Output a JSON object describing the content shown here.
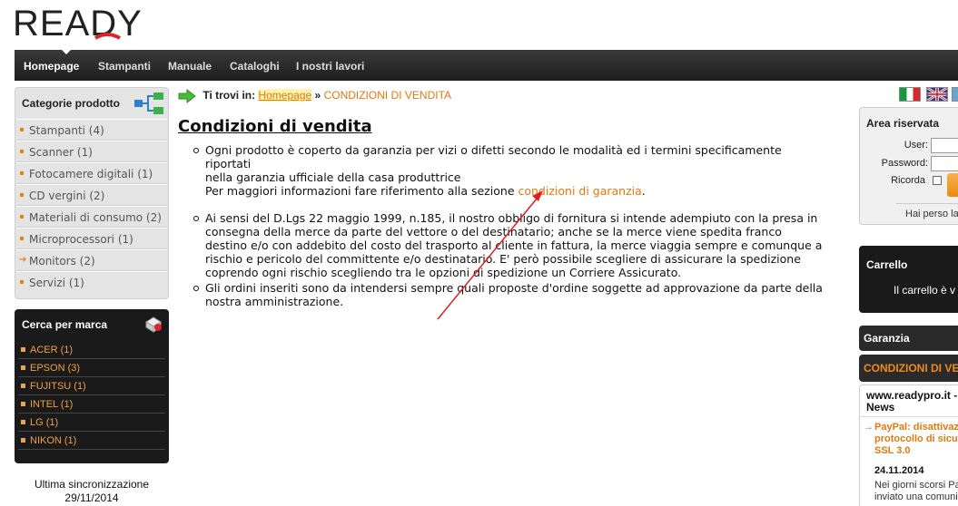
{
  "header": {
    "logo_text": "READY"
  },
  "nav": {
    "items": [
      {
        "label": "Homepage",
        "active": true
      },
      {
        "label": "Stampanti"
      },
      {
        "label": "Manuale"
      },
      {
        "label": "Cataloghi"
      },
      {
        "label": "I nostri lavori"
      }
    ]
  },
  "categories": {
    "title": "Categorie prodotto",
    "items": [
      {
        "label": "Stampanti (4)"
      },
      {
        "label": "Scanner (1)"
      },
      {
        "label": "Fotocamere digitali (1)"
      },
      {
        "label": "CD vergini (2)"
      },
      {
        "label": "Materiali di consumo (2)"
      },
      {
        "label": "Microprocessori (1)"
      },
      {
        "label": "Monitors (2)",
        "expandable": true
      },
      {
        "label": "Servizi (1)"
      }
    ]
  },
  "brands": {
    "title": "Cerca per marca",
    "items": [
      "ACER (1)",
      "EPSON (3)",
      "FUJITSU (1)",
      "INTEL (1)",
      "LG (1)",
      "NIKON (1)"
    ]
  },
  "sync": {
    "label": "Ultima sincronizzazione",
    "date": "29/11/2014"
  },
  "breadcrumb": {
    "label": "Ti trovi in:",
    "home": "Homepage",
    "separator": "»",
    "current": "CONDIZIONI DI VENDITA"
  },
  "page": {
    "title": "Condizioni di vendita",
    "p1_line1": "Ogni prodotto è coperto da garanzia per vizi o difetti secondo le modalità ed i termini specificamente riportati",
    "p1_line2": "nella garanzia ufficiale della casa produttrice",
    "p1_line3_pre": "Per maggiori informazioni fare riferimento alla sezione ",
    "p1_link": "condizioni di garanzia",
    "p1_line3_post": ".",
    "p2": "Ai sensi del D.Lgs 22 maggio 1999, n.185, il nostro obbligo di fornitura si intende adempiuto con la presa in consegna della merce da parte del vettore o del destinatario; anche se la merce viene spedita franco destino e/o con addebito del costo del trasporto al cliente in fattura, la merce viaggia sempre e comunque a rischio e pericolo del committente e/o destinatario. E' però possibile scegliere di assicurare la spedizione coprendo ogni rischio scegliendo tra le opzioni di spedizione un Corriere Assicurato.",
    "p3": "Gli ordini inseriti sono da intendersi sempre quali proposte d'ordine soggette ad approvazione da parte della nostra amministrazione."
  },
  "login": {
    "title": "Area riservata",
    "user_label": "User:",
    "password_label": "Password:",
    "remember_label": "Ricorda",
    "forgot": "Hai perso la"
  },
  "cart": {
    "title": "Carrello",
    "empty_text": "Il carrello è v"
  },
  "side_links": {
    "garanzia": "Garanzia",
    "condizioni": "CONDIZIONI DI VEN"
  },
  "news": {
    "title_line1": "www.readypro.it -",
    "title_line2": "News",
    "item_line1": "PayPal: disattivaz",
    "item_line2": "protocollo di sicu",
    "item_line3": "SSL 3.0",
    "date": "24.11.2014",
    "excerpt_line1": "Nei giorni scorsi Pay",
    "excerpt_line2": "inviato una comunic"
  },
  "colors": {
    "accent_orange": "#e07a10",
    "nav_bg": "#2a2a2a",
    "dark_box": "#1a1a1a"
  }
}
